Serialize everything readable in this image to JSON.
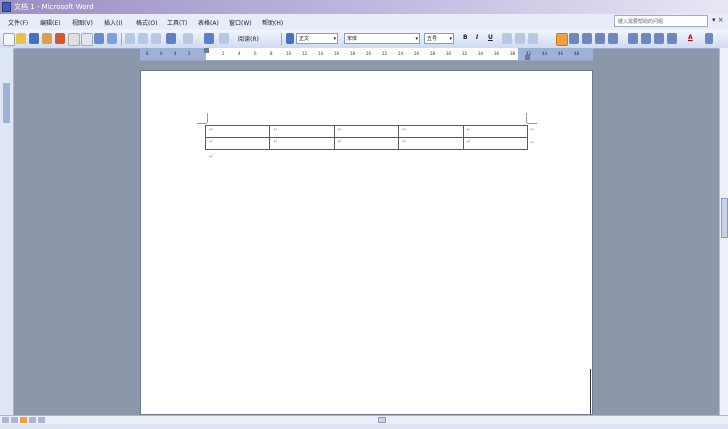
{
  "window": {
    "title": "文档 1 - Microsoft Word"
  },
  "menu": {
    "items": [
      "文件(F)",
      "编辑(E)",
      "视图(V)",
      "插入(I)",
      "格式(O)",
      "工具(T)",
      "表格(A)",
      "窗口(W)",
      "帮助(H)"
    ],
    "help_placeholder": "键入需要帮助的问题",
    "close_glyph": "▾ ×"
  },
  "toolbar": {
    "reading_label": "阅读(R)",
    "style_value": "正文",
    "font_value": "宋体",
    "size_value": "五号",
    "bold_label": "B",
    "italic_label": "I",
    "underline_label": "U",
    "font_color_label": "A"
  },
  "ruler": {
    "numbers": [
      "8",
      "6",
      "4",
      "2",
      "2",
      "4",
      "6",
      "8",
      "10",
      "12",
      "14",
      "16",
      "18",
      "20",
      "22",
      "24",
      "26",
      "28",
      "30",
      "32",
      "34",
      "36",
      "38",
      "42",
      "44",
      "46",
      "48"
    ]
  },
  "document": {
    "table": {
      "rows": 2,
      "cols": 5
    },
    "cell_mark": "↵",
    "para_mark": "↵"
  },
  "colors": {
    "accent": "#3c5fb5",
    "toolbar_bg": "#dde6f5",
    "workspace": "#8d97ab"
  }
}
